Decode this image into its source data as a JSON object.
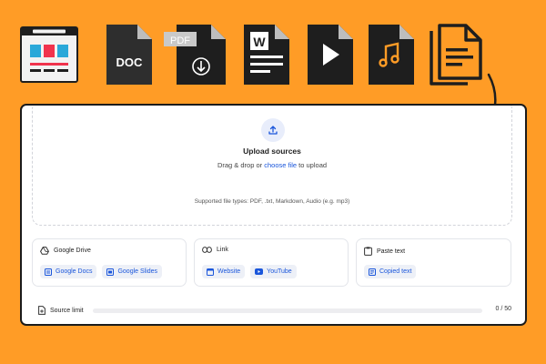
{
  "file_icons": [
    {
      "name": "website",
      "label": ""
    },
    {
      "name": "doc",
      "label": "DOC"
    },
    {
      "name": "pdf",
      "label": "PDF"
    },
    {
      "name": "word",
      "label": "W"
    },
    {
      "name": "video",
      "label": ""
    },
    {
      "name": "audio",
      "label": ""
    },
    {
      "name": "documents",
      "label": ""
    }
  ],
  "dropzone": {
    "title": "Upload sources",
    "sub_before": "Drag & drop or ",
    "sub_link": "choose file",
    "sub_after": " to upload",
    "supported": "Supported file types: PDF, .txt, Markdown, Audio (e.g. mp3)"
  },
  "cards": [
    {
      "title": "Google Drive",
      "icon": "google-drive-icon",
      "chips": [
        {
          "label": "Google Docs",
          "icon": "docs-icon"
        },
        {
          "label": "Google Slides",
          "icon": "slides-icon"
        }
      ]
    },
    {
      "title": "Link",
      "icon": "link-icon",
      "chips": [
        {
          "label": "Website",
          "icon": "website-icon"
        },
        {
          "label": "YouTube",
          "icon": "youtube-icon"
        }
      ]
    },
    {
      "title": "Paste text",
      "icon": "clipboard-icon",
      "chips": [
        {
          "label": "Copied text",
          "icon": "text-icon"
        }
      ]
    }
  ],
  "source_limit": {
    "label": "Source limit",
    "count": "0 / 50",
    "fraction": 0
  },
  "colors": {
    "background": "#FF9C26",
    "accent": "#1a56db",
    "icon_dark": "#1e1e1e"
  }
}
